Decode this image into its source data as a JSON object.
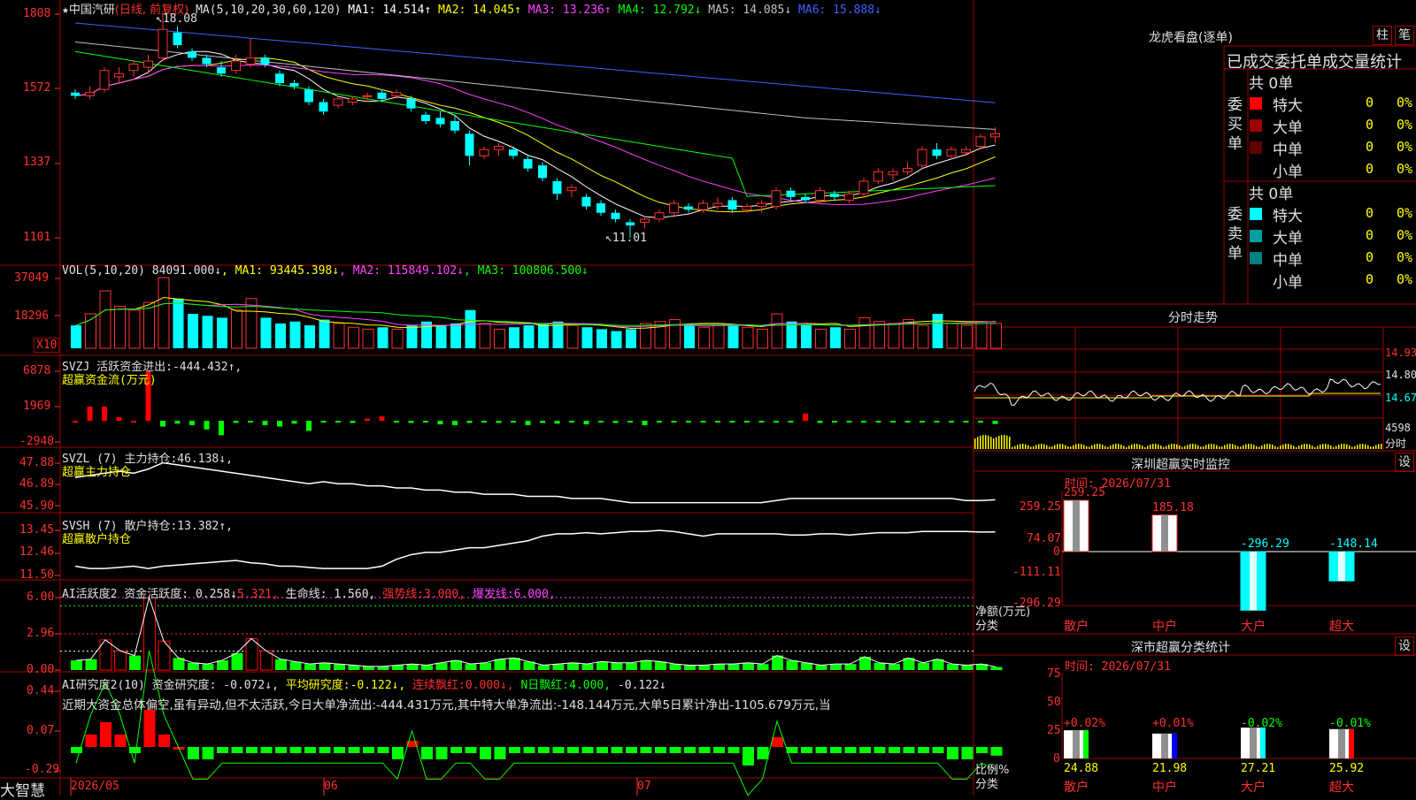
{
  "stock": {
    "star": "★",
    "name": "中国汽研",
    "period": "(日线, 前复权)"
  },
  "ma_line": {
    "label": "MA(5,10,20,30,60,120)",
    "items": [
      {
        "k": "MA1:",
        "v": "14.514↑",
        "color": "#ffffff"
      },
      {
        "k": "MA2:",
        "v": "14.045↑",
        "color": "#ffff00"
      },
      {
        "k": "MA3:",
        "v": "13.236↑",
        "color": "#ff40ff"
      },
      {
        "k": "MA4:",
        "v": "12.792↓",
        "color": "#00ff00"
      },
      {
        "k": "MA5:",
        "v": "14.085↓",
        "color": "#c0c0c0"
      },
      {
        "k": "MA6:",
        "v": "15.888↓",
        "color": "#4060ff"
      }
    ],
    "high_mark": "18.08",
    "low_mark": "11.01"
  },
  "price_axis": [
    "1808",
    "1572",
    "1337",
    "1101"
  ],
  "vol": {
    "header": "VOL(5,10,20)",
    "value": "84091.000↓",
    "ma": [
      {
        "k": "MA1:",
        "v": "93445.398↓",
        "color": "#ffff00"
      },
      {
        "k": "MA2:",
        "v": "115849.102↓",
        "color": "#ff40ff"
      },
      {
        "k": "MA3:",
        "v": "100806.500↓",
        "color": "#00ff00"
      }
    ],
    "axis": [
      "37049",
      "18296"
    ],
    "unit": "X10"
  },
  "svzj": {
    "header": "SVZJ  活跃资金进出:",
    "value": "-444.432↑,",
    "sub": "超赢资金流(万元)",
    "axis": [
      "6878",
      "1969",
      "-2940"
    ]
  },
  "svzl": {
    "header": "SVZL (7) 主力持仓:",
    "value": "46.138↓,",
    "sub": "超赢主力持仓",
    "axis": [
      "47.88",
      "46.89",
      "45.90"
    ]
  },
  "svsh": {
    "header": "SVSH (7) 散户持仓:",
    "value": "13.382↑,",
    "sub": "超赢散户持仓",
    "axis": [
      "13.45",
      "12.46",
      "11.50"
    ]
  },
  "ai1": {
    "header": "AI活跃度2 资金活跃度:",
    "v1": "0.258↓",
    "v2": "5.321,",
    "k3": "生命线:",
    "v3": "1.560,",
    "k4": "强势线:",
    "v4": "3.000,",
    "k5": "爆发线:",
    "v5": "6.000,",
    "axis": [
      "6.00",
      "2.96",
      "0.00"
    ]
  },
  "ai2": {
    "header": "AI研究度2(10) 资金研究度:",
    "v1": "-0.072↓,",
    "k2": "平均研究度:",
    "v2": "-0.122↓,",
    "k3": "连续飘红:",
    "v3": "0.000↓,",
    "k4": "N日飘红:",
    "v4": "4.000,",
    "v5": "-0.122↓",
    "comment": "近期大资金总体偏空,虽有异动,但不太活跃,今日大单净流出:-444.431万元,其中特大单净流出:-148.144万元,大单5日累计净出-1105.679万元,当",
    "axis": [
      "0.44",
      "0.07",
      "-0.29"
    ]
  },
  "xaxis": {
    "brand": "大智慧",
    "labels": [
      "2026/05",
      "06",
      "07"
    ]
  },
  "right": {
    "lhkp_title": "龙虎看盘(逐单)",
    "btn_zhu": "柱",
    "btn_bi": "笔",
    "tabs": "已成交委托单成交量统计",
    "buy": {
      "side": "委买单",
      "total": "共 0单",
      "rows": [
        {
          "n": "特大",
          "v": "0",
          "p": "0%",
          "c": "#ff0000"
        },
        {
          "n": "大单",
          "v": "0",
          "p": "0%",
          "c": "#a00000"
        },
        {
          "n": "中单",
          "v": "0",
          "p": "0%",
          "c": "#600000"
        },
        {
          "n": "小单",
          "v": "0",
          "p": "0%",
          "c": "#000000"
        }
      ]
    },
    "sell": {
      "side": "委卖单",
      "total": "共 0单",
      "rows": [
        {
          "n": "特大",
          "v": "0",
          "p": "0%",
          "c": "#00ffff"
        },
        {
          "n": "大单",
          "v": "0",
          "p": "0%",
          "c": "#00a0a0"
        },
        {
          "n": "中单",
          "v": "0",
          "p": "0%",
          "c": "#008080"
        },
        {
          "n": "小单",
          "v": "0",
          "p": "0%",
          "c": "#000000"
        }
      ]
    },
    "fs_title": "分时走势",
    "fs_axis": [
      "14.93",
      "14.80",
      "14.67",
      "4598",
      "分时"
    ],
    "mon_title": "深圳超赢实时监控",
    "mon_set": "设",
    "mon_time": "时间: 2026/07/31",
    "mon_axis": [
      "259.25",
      "74.07",
      "0",
      "-111.11",
      "-296.29"
    ],
    "mon_ylabel": "净额(万元)",
    "mon_xlabel": "分类",
    "mon_bars": [
      {
        "n": "散户",
        "v": 259.25,
        "t": "259.25"
      },
      {
        "n": "中户",
        "v": 185.18,
        "t": "185.18"
      },
      {
        "n": "大户",
        "v": -296.29,
        "t": "-296.29"
      },
      {
        "n": "超大",
        "v": -148.14,
        "t": "-148.14"
      }
    ],
    "cls_title": "深市超赢分类统计",
    "cls_set": "设",
    "cls_time": "时间: 2026/07/31",
    "cls_axis": [
      "75",
      "50",
      "25",
      "0"
    ],
    "cls_ylabel": "比例%",
    "cls_xlabel": "分类",
    "cls_bars": [
      {
        "n": "散户",
        "pct": "+0.02%",
        "v": 24.88,
        "t": "24.88"
      },
      {
        "n": "中户",
        "pct": "+0.01%",
        "v": 21.98,
        "t": "21.98"
      },
      {
        "n": "大户",
        "pct": "-0.02%",
        "v": 27.21,
        "t": "27.21"
      },
      {
        "n": "超大",
        "pct": "-0.01%",
        "v": 25.92,
        "t": "25.92"
      }
    ]
  },
  "chart_data": {
    "type": "candlestick",
    "title": "中国汽研",
    "period": "日线 前复权",
    "y_range": [
      11.01,
      18.08
    ],
    "ohlc": [
      [
        15.6,
        15.7,
        15.4,
        15.5
      ],
      [
        15.5,
        15.8,
        15.4,
        15.6
      ],
      [
        15.7,
        16.4,
        15.6,
        16.3
      ],
      [
        16.1,
        16.4,
        15.9,
        16.2
      ],
      [
        16.3,
        16.6,
        16.1,
        16.5
      ],
      [
        16.4,
        16.8,
        16.2,
        16.6
      ],
      [
        16.7,
        18.08,
        16.6,
        17.6
      ],
      [
        17.5,
        17.7,
        17.0,
        17.1
      ],
      [
        16.9,
        17.0,
        16.6,
        16.7
      ],
      [
        16.7,
        16.8,
        16.4,
        16.5
      ],
      [
        16.4,
        16.6,
        16.1,
        16.2
      ],
      [
        16.3,
        16.8,
        16.2,
        16.6
      ],
      [
        16.5,
        17.3,
        16.4,
        16.7
      ],
      [
        16.7,
        16.8,
        16.4,
        16.5
      ],
      [
        16.2,
        16.3,
        15.8,
        15.9
      ],
      [
        15.9,
        16.0,
        15.7,
        15.8
      ],
      [
        15.7,
        15.8,
        15.2,
        15.3
      ],
      [
        15.3,
        15.4,
        14.9,
        15.0
      ],
      [
        15.2,
        15.5,
        15.1,
        15.4
      ],
      [
        15.3,
        15.5,
        15.2,
        15.4
      ],
      [
        15.5,
        15.6,
        15.3,
        15.5
      ],
      [
        15.6,
        15.7,
        15.3,
        15.4
      ],
      [
        15.5,
        15.7,
        15.4,
        15.6
      ],
      [
        15.4,
        15.5,
        15.0,
        15.1
      ],
      [
        14.9,
        15.0,
        14.6,
        14.7
      ],
      [
        14.8,
        15.0,
        14.5,
        14.6
      ],
      [
        14.7,
        14.9,
        14.3,
        14.4
      ],
      [
        14.3,
        14.4,
        13.3,
        13.6
      ],
      [
        13.6,
        13.9,
        13.5,
        13.8
      ],
      [
        13.8,
        14.0,
        13.6,
        13.9
      ],
      [
        13.8,
        13.9,
        13.5,
        13.6
      ],
      [
        13.5,
        13.6,
        13.1,
        13.2
      ],
      [
        13.3,
        13.4,
        12.8,
        12.9
      ],
      [
        12.8,
        12.9,
        12.2,
        12.4
      ],
      [
        12.5,
        12.7,
        12.3,
        12.6
      ],
      [
        12.3,
        12.4,
        11.9,
        12.0
      ],
      [
        12.1,
        12.2,
        11.7,
        11.8
      ],
      [
        11.8,
        11.9,
        11.5,
        11.6
      ],
      [
        11.5,
        11.6,
        11.01,
        11.4
      ],
      [
        11.5,
        11.7,
        11.3,
        11.6
      ],
      [
        11.6,
        11.9,
        11.5,
        11.8
      ],
      [
        11.8,
        12.2,
        11.7,
        12.1
      ],
      [
        12.0,
        12.1,
        11.8,
        11.9
      ],
      [
        11.9,
        12.2,
        11.8,
        12.1
      ],
      [
        12.0,
        12.3,
        11.9,
        12.1
      ],
      [
        12.2,
        12.3,
        11.8,
        11.9
      ],
      [
        11.9,
        12.1,
        11.8,
        12.0
      ],
      [
        12.0,
        12.2,
        11.8,
        12.1
      ],
      [
        12.0,
        12.6,
        11.9,
        12.5
      ],
      [
        12.5,
        12.6,
        12.2,
        12.3
      ],
      [
        12.3,
        12.4,
        12.1,
        12.2
      ],
      [
        12.2,
        12.6,
        12.1,
        12.5
      ],
      [
        12.4,
        12.5,
        12.2,
        12.3
      ],
      [
        12.2,
        12.5,
        12.1,
        12.4
      ],
      [
        12.4,
        12.9,
        12.3,
        12.8
      ],
      [
        12.8,
        13.2,
        12.7,
        13.1
      ],
      [
        13.0,
        13.2,
        12.8,
        13.1
      ],
      [
        13.1,
        13.4,
        13.0,
        13.2
      ],
      [
        13.3,
        13.9,
        13.2,
        13.8
      ],
      [
        13.8,
        14.0,
        13.5,
        13.6
      ],
      [
        13.6,
        13.9,
        13.5,
        13.8
      ],
      [
        13.7,
        13.9,
        13.6,
        13.8
      ],
      [
        13.9,
        14.3,
        13.8,
        14.2
      ],
      [
        14.2,
        14.5,
        14.0,
        14.3
      ]
    ],
    "ma_series": [
      {
        "name": "MA1",
        "color": "#ffffff"
      },
      {
        "name": "MA2",
        "color": "#ffff00"
      },
      {
        "name": "MA3",
        "color": "#ff40ff"
      },
      {
        "name": "MA4",
        "color": "#00ff00"
      },
      {
        "name": "MA5",
        "color": "#c0c0c0"
      },
      {
        "name": "MA6",
        "color": "#4060ff"
      }
    ],
    "volume": [
      12,
      18,
      30,
      22,
      20,
      24,
      37,
      26,
      18,
      17,
      16,
      20,
      26,
      16,
      13,
      14,
      12,
      15,
      13,
      11,
      10,
      11,
      10,
      12,
      14,
      12,
      13,
      20,
      13,
      10,
      11,
      12,
      13,
      14,
      12,
      11,
      10,
      9,
      10,
      13,
      14,
      15,
      12,
      11,
      13,
      12,
      11,
      10,
      18,
      14,
      12,
      10,
      11,
      10,
      16,
      14,
      13,
      15,
      12,
      18,
      13,
      12,
      14,
      13
    ],
    "svzj": [
      0,
      1969,
      1969,
      500,
      0,
      6878,
      -800,
      -400,
      -600,
      -1200,
      -2000,
      -300,
      -100,
      -600,
      -800,
      -400,
      -1400,
      -200,
      -100,
      -300,
      300,
      600,
      -200,
      -300,
      -200,
      -500,
      -600,
      -300,
      -100,
      -300,
      -200,
      -600,
      -300,
      -400,
      -200,
      -500,
      -200,
      -300,
      -100,
      -600,
      -200,
      -100,
      -100,
      -150,
      -200,
      -100,
      -150,
      -100,
      -200,
      -150,
      1000,
      -300,
      -100,
      -150,
      -100,
      -200,
      -100,
      -150,
      -100,
      -120,
      -100,
      -150,
      -100,
      -444
    ],
    "svzl": [
      47.2,
      47.3,
      47.4,
      47.5,
      47.4,
      47.6,
      47.9,
      47.8,
      47.7,
      47.6,
      47.5,
      47.4,
      47.3,
      47.2,
      47.1,
      47.0,
      46.9,
      47.0,
      46.9,
      46.9,
      46.8,
      46.8,
      46.7,
      46.7,
      46.6,
      46.6,
      46.5,
      46.5,
      46.4,
      46.4,
      46.4,
      46.3,
      46.3,
      46.3,
      46.2,
      46.2,
      46.2,
      46.1,
      46.0,
      46.0,
      46.0,
      46.0,
      46.0,
      46.0,
      46.0,
      46.0,
      46.0,
      46.0,
      46.1,
      46.2,
      46.2,
      46.2,
      46.2,
      46.2,
      46.2,
      46.2,
      46.2,
      46.2,
      46.2,
      46.2,
      46.2,
      46.1,
      46.1,
      46.138
    ],
    "svsh": [
      11.9,
      11.8,
      11.8,
      11.85,
      11.9,
      11.8,
      11.9,
      11.95,
      12.0,
      12.05,
      12.1,
      12.15,
      12.05,
      12.0,
      11.9,
      11.9,
      11.85,
      11.8,
      11.8,
      11.8,
      11.8,
      11.9,
      12.2,
      12.4,
      12.5,
      12.5,
      12.6,
      12.7,
      12.7,
      12.8,
      12.9,
      13.0,
      13.2,
      13.3,
      13.3,
      13.35,
      13.3,
      13.35,
      13.4,
      13.4,
      13.45,
      13.4,
      13.3,
      13.2,
      13.3,
      13.3,
      13.3,
      13.3,
      13.3,
      13.25,
      13.25,
      13.3,
      13.3,
      13.25,
      13.3,
      13.35,
      13.35,
      13.35,
      13.4,
      13.4,
      13.4,
      13.4,
      13.38,
      13.382
    ],
    "ai_active": [
      0.8,
      0.9,
      2.5,
      1.6,
      1.2,
      6.0,
      2.4,
      1.0,
      0.6,
      0.5,
      0.8,
      1.4,
      2.6,
      1.6,
      0.9,
      0.7,
      0.5,
      0.6,
      0.5,
      0.4,
      0.3,
      0.3,
      0.4,
      0.5,
      0.4,
      0.6,
      0.8,
      0.5,
      0.6,
      0.9,
      1.0,
      0.7,
      0.4,
      0.5,
      0.6,
      0.5,
      0.7,
      0.6,
      0.6,
      0.8,
      0.7,
      0.5,
      0.4,
      0.4,
      0.5,
      0.5,
      0.6,
      0.5,
      1.2,
      0.8,
      0.6,
      0.4,
      0.5,
      0.5,
      1.1,
      0.6,
      0.5,
      1.0,
      0.6,
      0.9,
      0.5,
      0.4,
      0.5,
      0.26
    ],
    "ai_research": [
      -0.05,
      0.1,
      0.2,
      0.1,
      -0.05,
      0.3,
      0.1,
      0.0,
      -0.1,
      -0.1,
      -0.05,
      -0.05,
      -0.05,
      -0.05,
      -0.05,
      -0.05,
      -0.05,
      -0.05,
      -0.05,
      -0.05,
      -0.05,
      -0.05,
      -0.1,
      0.05,
      -0.1,
      -0.1,
      -0.05,
      -0.05,
      -0.1,
      -0.1,
      -0.05,
      -0.05,
      -0.05,
      -0.05,
      -0.05,
      -0.05,
      -0.05,
      -0.05,
      -0.05,
      -0.05,
      -0.05,
      -0.05,
      -0.05,
      -0.05,
      -0.05,
      -0.05,
      -0.15,
      -0.1,
      0.08,
      -0.05,
      -0.05,
      -0.05,
      -0.05,
      -0.05,
      -0.05,
      -0.05,
      -0.05,
      -0.05,
      -0.05,
      -0.05,
      -0.1,
      -0.1,
      -0.05,
      -0.07
    ]
  }
}
